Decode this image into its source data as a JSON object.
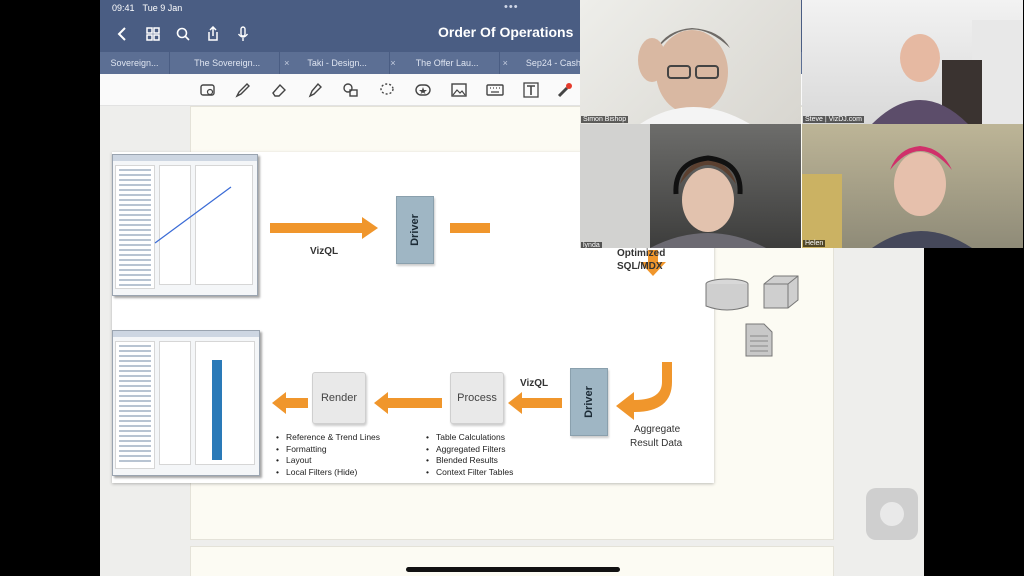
{
  "status": {
    "time": "09:41",
    "date": "Tue 9 Jan"
  },
  "document": {
    "title": "Order Of Operations"
  },
  "tabs": [
    {
      "label": "Sovereign..."
    },
    {
      "label": "The Sovereign..."
    },
    {
      "label": "Taki - Design..."
    },
    {
      "label": "The Offer Lau..."
    },
    {
      "label": "Sep24 - Cash..."
    }
  ],
  "toolbar_icons": [
    "lasso-image-icon",
    "pen-icon",
    "eraser-icon",
    "highlighter-icon",
    "shapes-icon",
    "lasso-icon",
    "sticker-icon",
    "image-icon",
    "keyboard-icon",
    "text-icon",
    "laser-pointer-icon"
  ],
  "slide": {
    "vizql": "VizQL",
    "driver": "Driver",
    "optimized_line1": "Optimized",
    "optimized_line2": "SQL/MDX",
    "aggregate_line1": "Aggregate",
    "aggregate_line2": "Result Data",
    "process": "Process",
    "render": "Render",
    "vizql_bottom": "VizQL",
    "render_bullets": [
      "Reference & Trend Lines",
      "Formatting",
      "Layout",
      "Local Filters (Hide)"
    ],
    "process_bullets": [
      "Table Calculations",
      "Aggregated Filters",
      "Blended Results",
      "Context Filter Tables"
    ]
  },
  "participants": [
    {
      "name": "Simon Bishop"
    },
    {
      "name": "Steve | VizDJ.com"
    },
    {
      "name": "lynda"
    },
    {
      "name": "Helen"
    }
  ],
  "colors": {
    "nav": "#4a5d83",
    "arrow": "#f0962c",
    "driver": "#9fb6c4"
  }
}
